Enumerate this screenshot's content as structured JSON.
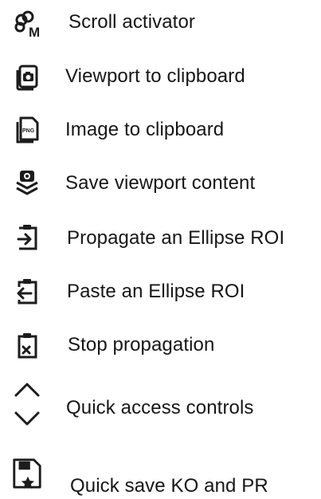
{
  "menu": {
    "items": [
      {
        "id": "scroll-activator",
        "label": "Scroll activator",
        "icon": "scroll-activator-icon"
      },
      {
        "id": "viewport-to-clipboard",
        "label": "Viewport to clipboard",
        "icon": "camera-clipboard-icon"
      },
      {
        "id": "image-to-clipboard",
        "label": "Image to clipboard",
        "icon": "png-file-icon"
      },
      {
        "id": "save-viewport-content",
        "label": "Save viewport content",
        "icon": "camera-download-icon"
      },
      {
        "id": "propagate-ellipse-roi",
        "label": "Propagate an Ellipse ROI",
        "icon": "clipboard-arrow-right-icon"
      },
      {
        "id": "paste-ellipse-roi",
        "label": "Paste an Ellipse ROI",
        "icon": "clipboard-arrow-left-icon"
      },
      {
        "id": "stop-propagation",
        "label": "Stop propagation",
        "icon": "clipboard-x-icon"
      },
      {
        "id": "quick-access-controls",
        "label": "Quick access controls",
        "icon": "chevron-up-down-icon"
      },
      {
        "id": "quick-save-ko-pr",
        "label": "Quick save KO and PR",
        "icon": "save-star-icon"
      }
    ],
    "png_badge_text": "PNG",
    "scroll_badge_text": "M",
    "icon_color": "#1c1c1c"
  }
}
